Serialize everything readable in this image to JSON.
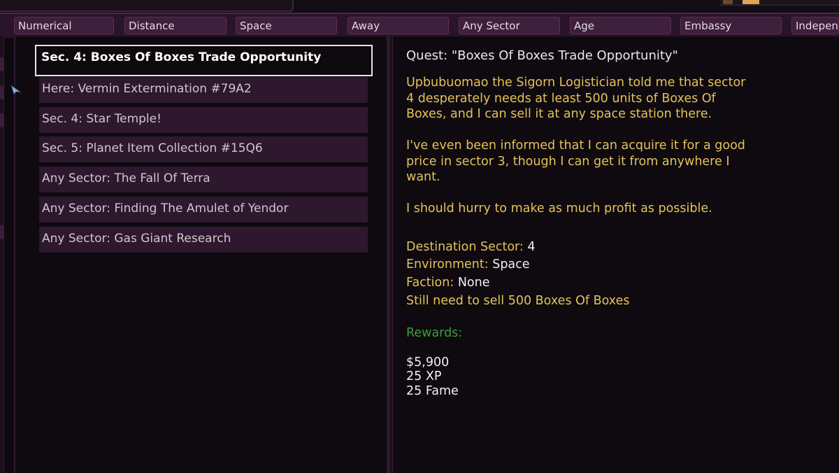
{
  "tabs": [
    {
      "label": "Numerical",
      "active": true
    },
    {
      "label": "Distance",
      "active": false
    },
    {
      "label": "Space",
      "active": false
    },
    {
      "label": "Away",
      "active": false
    },
    {
      "label": "Any Sector",
      "active": false
    },
    {
      "label": "Age",
      "active": false
    },
    {
      "label": "Embassy",
      "active": false
    },
    {
      "label": "Independe",
      "active": false
    }
  ],
  "quests": [
    {
      "label": "Sec. 4: Boxes Of Boxes Trade Opportunity",
      "selected": true
    },
    {
      "label": "Here: Vermin Extermination #79A2",
      "selected": false
    },
    {
      "label": "Sec. 4: Star Temple!",
      "selected": false
    },
    {
      "label": "Sec. 5: Planet Item Collection #15Q6",
      "selected": false
    },
    {
      "label": "Any Sector: The Fall Of Terra",
      "selected": false
    },
    {
      "label": "Any Sector: Finding The Amulet of Yendor",
      "selected": false
    },
    {
      "label": "Any Sector: Gas Giant Research",
      "selected": false
    }
  ],
  "details": {
    "title": "Quest: \"Boxes Of Boxes Trade Opportunity\"",
    "paragraph1": [
      "Upbubuomao the Sigorn Logistician told me that sector",
      "4 desperately needs at least 500 units of Boxes Of",
      "Boxes, and I can sell it at any space station there."
    ],
    "paragraph2": [
      "I've even been informed that I can acquire it for a good",
      "price in sector 3, though I can get it from anywhere I",
      "want."
    ],
    "paragraph3": [
      "I should hurry to make as much profit as possible."
    ],
    "destination_label": "Destination Sector:",
    "destination_value": "4",
    "environment_label": "Environment:",
    "environment_value": "Space",
    "faction_label": "Faction:",
    "faction_value": "None",
    "still_need": "Still need to sell 500 Boxes Of Boxes",
    "rewards_label": "Rewards:",
    "rewards": [
      "$5,900",
      "25 XP",
      "25 Fame"
    ]
  },
  "colors": {
    "accent_tab": "#a02f9e",
    "quest_row": "#2e182d",
    "description_text": "#e4c25a",
    "rewards_label": "#3c9e38"
  }
}
